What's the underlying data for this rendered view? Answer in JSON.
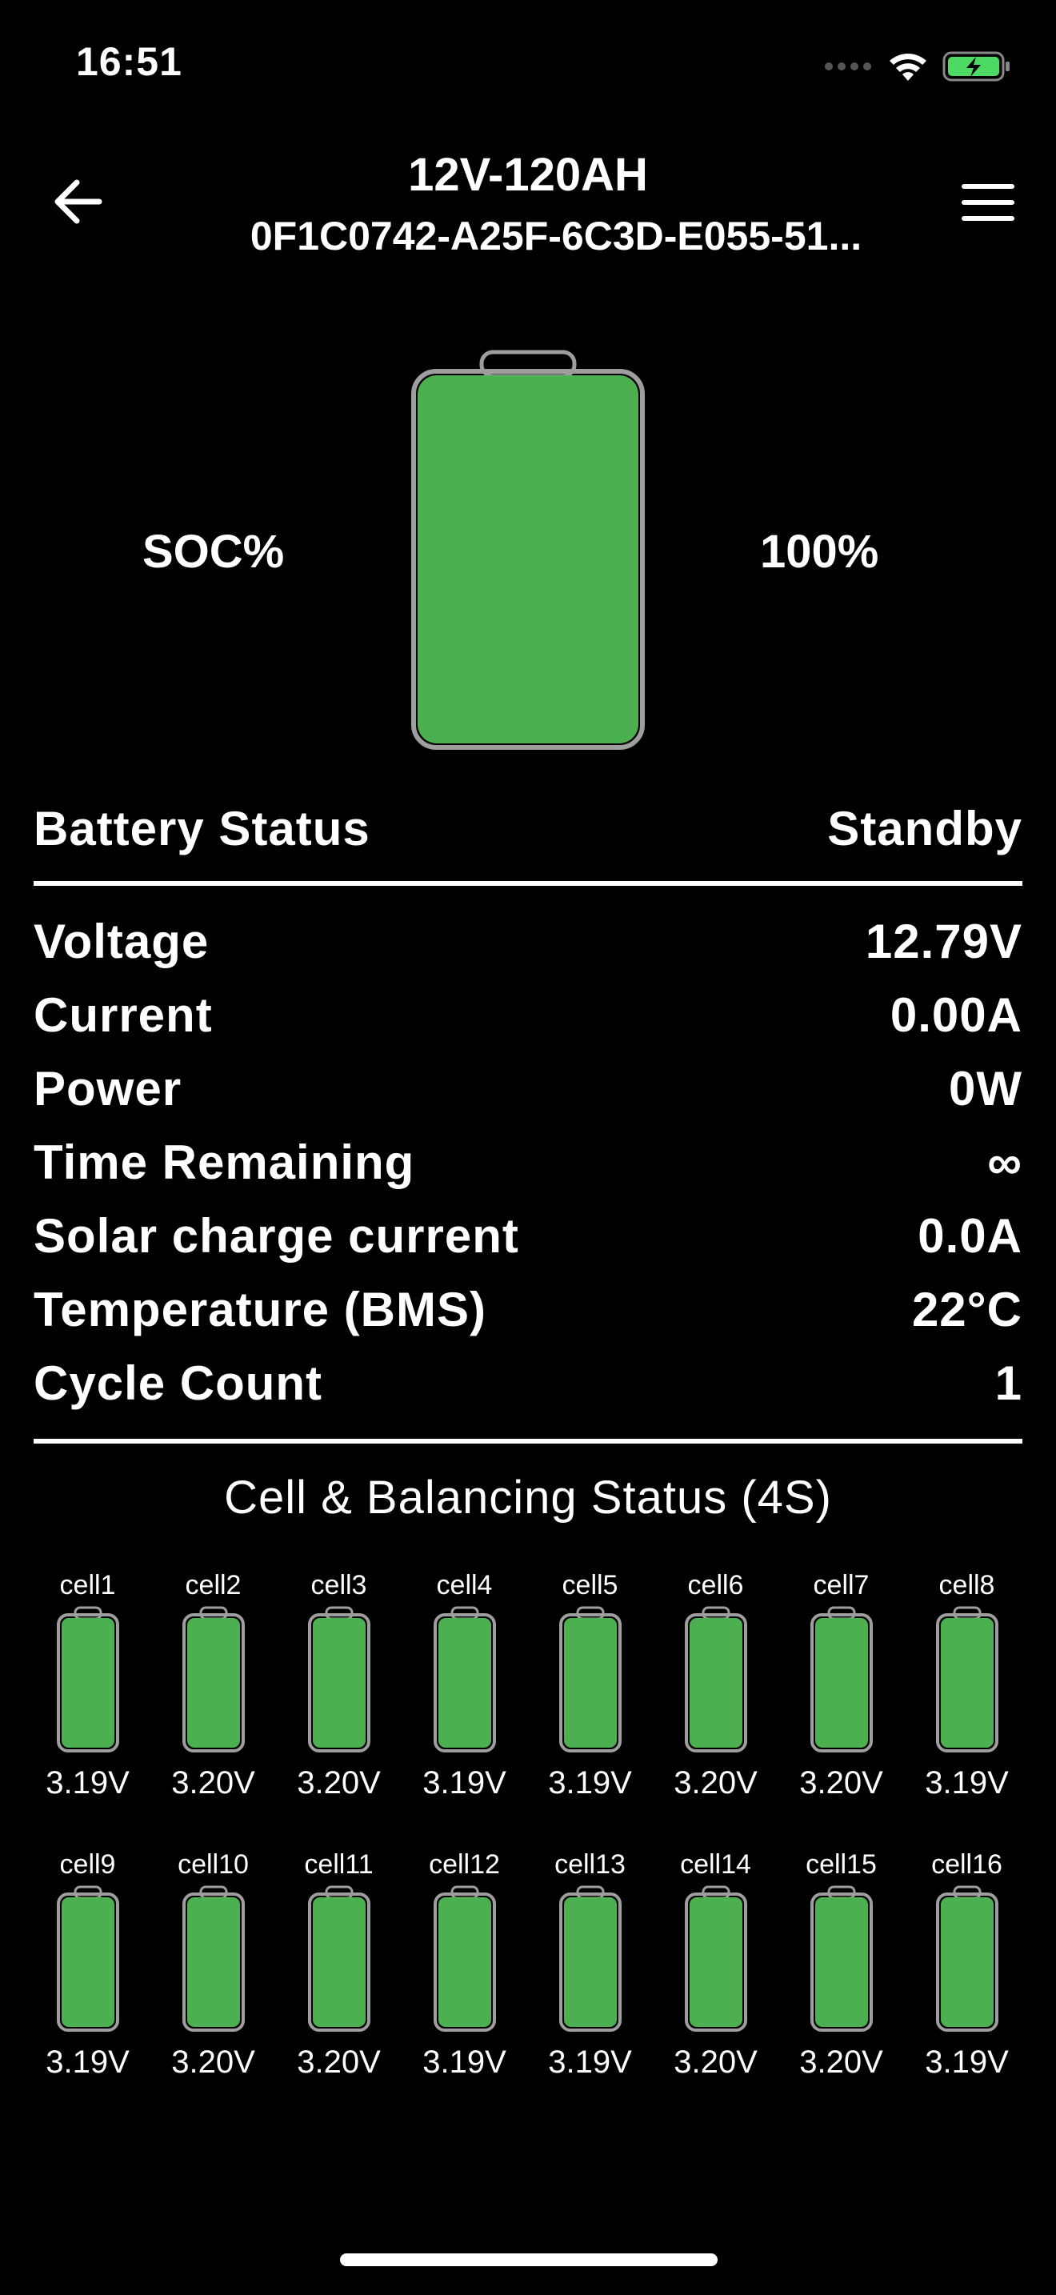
{
  "status_bar": {
    "time": "16:51"
  },
  "nav": {
    "title": "12V-120AH",
    "subtitle": "0F1C0742-A25F-6C3D-E055-51..."
  },
  "soc": {
    "label": "SOC%",
    "value": "100%",
    "level": 1.0
  },
  "battery_status": {
    "label": "Battery Status",
    "value": "Standby"
  },
  "metrics": [
    {
      "label": "Voltage",
      "value": "12.79V"
    },
    {
      "label": "Current",
      "value": "0.00A"
    },
    {
      "label": "Power",
      "value": "0W"
    },
    {
      "label": "Time Remaining",
      "value": "∞"
    },
    {
      "label": "Solar charge current",
      "value": "0.0A"
    },
    {
      "label": "Temperature (BMS)",
      "value": "22°C"
    },
    {
      "label": "Cycle Count",
      "value": "1"
    }
  ],
  "cells_section": {
    "title": "Cell & Balancing Status (4S)"
  },
  "cells": [
    {
      "name": "cell1",
      "voltage": "3.19V"
    },
    {
      "name": "cell2",
      "voltage": "3.20V"
    },
    {
      "name": "cell3",
      "voltage": "3.20V"
    },
    {
      "name": "cell4",
      "voltage": "3.19V"
    },
    {
      "name": "cell5",
      "voltage": "3.19V"
    },
    {
      "name": "cell6",
      "voltage": "3.20V"
    },
    {
      "name": "cell7",
      "voltage": "3.20V"
    },
    {
      "name": "cell8",
      "voltage": "3.19V"
    },
    {
      "name": "cell9",
      "voltage": "3.19V"
    },
    {
      "name": "cell10",
      "voltage": "3.20V"
    },
    {
      "name": "cell11",
      "voltage": "3.20V"
    },
    {
      "name": "cell12",
      "voltage": "3.19V"
    },
    {
      "name": "cell13",
      "voltage": "3.19V"
    },
    {
      "name": "cell14",
      "voltage": "3.20V"
    },
    {
      "name": "cell15",
      "voltage": "3.20V"
    },
    {
      "name": "cell16",
      "voltage": "3.19V"
    }
  ],
  "colors": {
    "background": "#000000",
    "battery_fill": "#4CB050",
    "battery_outline": "#9E9E9E",
    "status_battery": "#4CD964"
  },
  "icons": {
    "back": "arrow-left-icon",
    "menu": "hamburger-menu-icon",
    "signal": "cellular-signal-icon",
    "wifi": "wifi-icon",
    "battery": "charging-battery-icon"
  }
}
